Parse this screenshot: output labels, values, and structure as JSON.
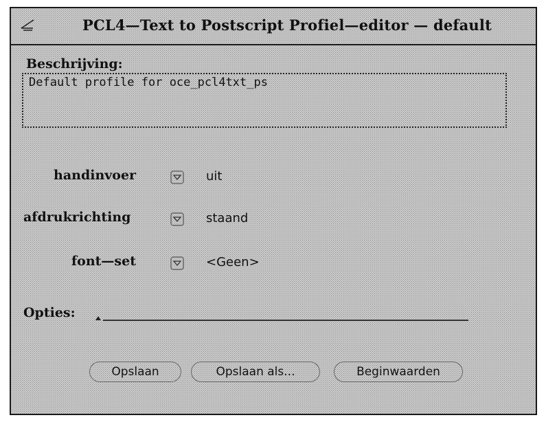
{
  "window": {
    "title": "PCL4—Text to Postscript Profiel—editor —  default",
    "menu_icon": "window-menu-icon"
  },
  "description": {
    "label": "Beschrijving:",
    "value": "Default profile for oce_pcl4txt_ps"
  },
  "settings": {
    "handinvoer": {
      "label": "handinvoer",
      "value": "uit",
      "icon": "menu-button-icon"
    },
    "afdrukrichting": {
      "label": "afdrukrichting",
      "value": "staand",
      "icon": "menu-button-icon"
    },
    "font_set": {
      "label": "font—set",
      "value": "<Geen>",
      "icon": "menu-button-icon"
    }
  },
  "options": {
    "label": "Opties:",
    "value": ""
  },
  "buttons": {
    "save": "Opslaan",
    "save_as": "Opslaan als...",
    "defaults": "Beginwaarden"
  },
  "colors": {
    "background": "#dcdcdc",
    "stipple": "#8a8a8a",
    "text": "#111111"
  }
}
